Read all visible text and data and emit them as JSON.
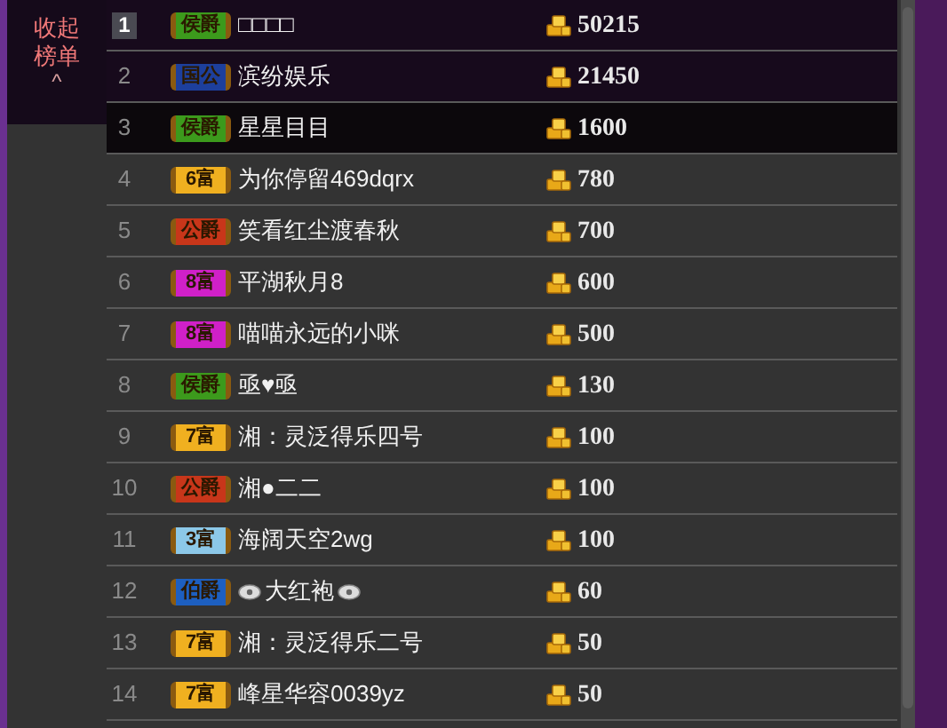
{
  "collapse": {
    "label": "收起榜单",
    "arrow": "^"
  },
  "rows": [
    {
      "rank": "1",
      "kind": "top",
      "badge": "侯爵",
      "color": "#3c9a1c",
      "name": "□□□□",
      "value": "50215"
    },
    {
      "rank": "2",
      "kind": "normal",
      "badge": "国公",
      "color": "#1d3f9c",
      "name": "滨纷娱乐",
      "value": "21450"
    },
    {
      "rank": "3",
      "kind": "normal",
      "badge": "侯爵",
      "color": "#3c9a1c",
      "name": "星星目目",
      "value": "1600"
    },
    {
      "rank": "4",
      "kind": "normal",
      "badge": "6富",
      "color": "#f0b020",
      "name": "为你停留469dqrx",
      "value": "780"
    },
    {
      "rank": "5",
      "kind": "normal",
      "badge": "公爵",
      "color": "#c8361a",
      "name": "笑看红尘渡春秋",
      "value": "700"
    },
    {
      "rank": "6",
      "kind": "normal",
      "badge": "8富",
      "color": "#d020c8",
      "name": "平湖秋月8",
      "value": "600"
    },
    {
      "rank": "7",
      "kind": "normal",
      "badge": "8富",
      "color": "#d020c8",
      "name": "喵喵永远的小咪",
      "value": "500"
    },
    {
      "rank": "8",
      "kind": "normal",
      "badge": "侯爵",
      "color": "#3c9a1c",
      "name": "亟♥亟",
      "value": "130"
    },
    {
      "rank": "9",
      "kind": "normal",
      "badge": "7富",
      "color": "#f0b020",
      "name": "湘：灵泛得乐四号",
      "value": "100"
    },
    {
      "rank": "10",
      "kind": "normal",
      "badge": "公爵",
      "color": "#c8361a",
      "name": "湘●二二",
      "value": "100"
    },
    {
      "rank": "11",
      "kind": "normal",
      "badge": "3富",
      "color": "#8cc8e8",
      "name": "海阔天空2wg",
      "value": "100"
    },
    {
      "rank": "12",
      "kind": "normal",
      "badge": "伯爵",
      "color": "#1d5fc0",
      "name": "大红袍",
      "decorated": true,
      "value": "60"
    },
    {
      "rank": "13",
      "kind": "normal",
      "badge": "7富",
      "color": "#f0b020",
      "name": "湘：灵泛得乐二号",
      "value": "50"
    },
    {
      "rank": "14",
      "kind": "normal",
      "badge": "7富",
      "color": "#f0b020",
      "name": "峰星华容0039yz",
      "value": "50"
    }
  ]
}
